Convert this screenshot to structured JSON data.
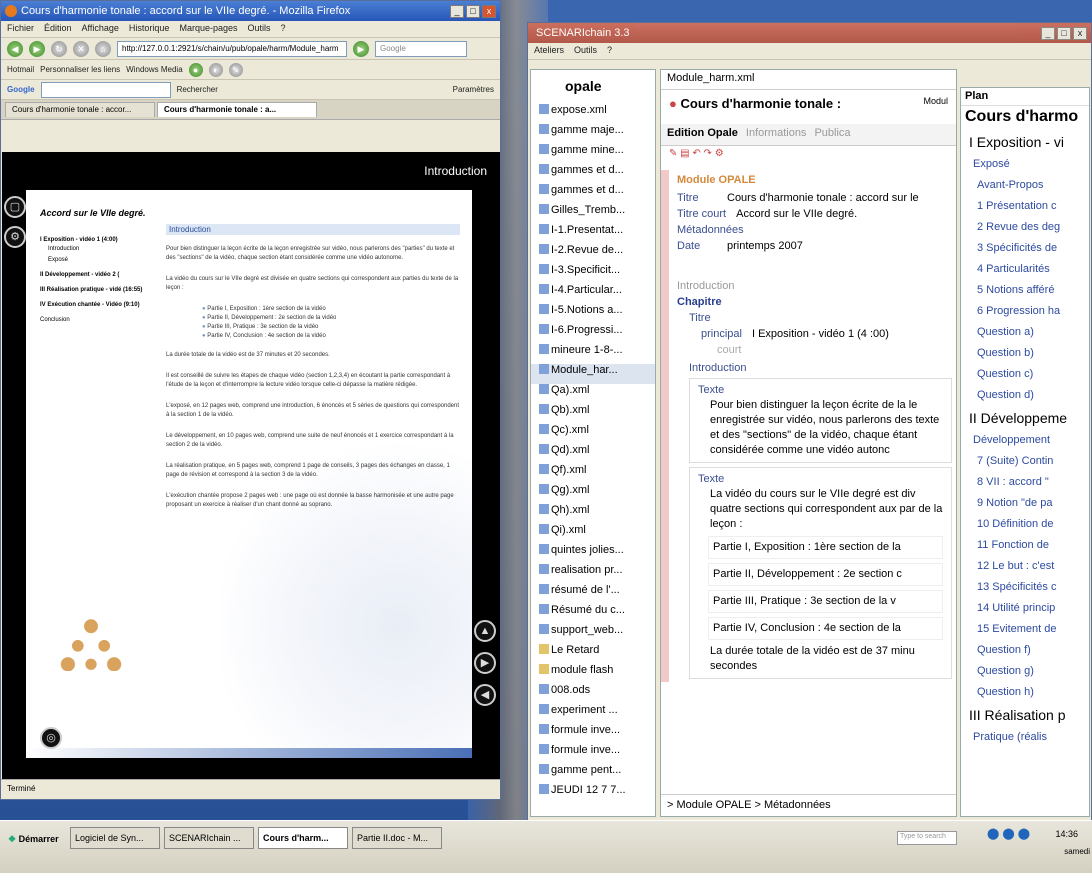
{
  "firefox": {
    "title": "Cours d'harmonie tonale : accord sur le VIIe degré. - Mozilla Firefox",
    "menu": [
      "Fichier",
      "Édition",
      "Affichage",
      "Historique",
      "Marque-pages",
      "Outils",
      "?"
    ],
    "url": "http://127.0.0.1:2921/s/chain/u/pub/opale/harm/Module_harm",
    "search_engine": "Google",
    "bookmarks": [
      "Hotmail",
      "Personnaliser les liens",
      "Windows Media"
    ],
    "google_toolbar": {
      "label": "Google",
      "search_button": "Rechercher",
      "settings": "Paramètres"
    },
    "tabs": [
      "Cours d'harmonie tonale : accor...",
      "Cours d'harmonie tonale : a..."
    ],
    "status": "Terminé",
    "flash": {
      "section_title": "Introduction",
      "page_title": "Accord sur le VIIe degré.",
      "nav": [
        {
          "label": "I Exposition - vidéo 1 (4:00)",
          "subs": [
            "Introduction",
            "Exposé"
          ]
        },
        {
          "label": "II Développement - vidéo 2 (",
          "subs": []
        },
        {
          "label": "III Réalisation pratique - vidé (16:55)",
          "subs": []
        },
        {
          "label": "IV Exécution chantée - Vidéo (9:10)",
          "subs": []
        },
        {
          "label": "Conclusion",
          "subs": []
        }
      ],
      "body_head": "Introduction",
      "paragraphs": [
        "Pour bien distinguer la leçon écrite de la leçon enregistrée sur vidéo, nous parlerons des \"parties\" du texte et des \"sections\" de la vidéo, chaque section étant considérée comme une vidéo autonome.",
        "La vidéo du cours sur le VIIe degré est divisée en quatre sections qui correspondent aux parties du texte de la leçon :"
      ],
      "bullets": [
        "Partie I, Exposition : 1ère section de la vidéo",
        "Partie II, Développement : 2e section de la vidéo",
        "Partie III, Pratique : 3e section de la vidéo",
        "Partie IV, Conclusion : 4e section de la vidéo"
      ],
      "paragraphs2": [
        "La durée totale de la vidéo est de 37 minutes et 20 secondes.",
        "Il est conseillé de suivre les étapes de chaque vidéo (section 1,2,3,4) en écoutant la partie correspondant à l'étude de la leçon et d'interrompre la lecture vidéo lorsque celle-ci dépasse la matière rédigée.",
        "L'exposé, en 12 pages web, comprend une introduction, 6 énoncés et 5 séries de questions qui correspondent à la section 1 de la vidéo.",
        "Le développement, en 10 pages web, comprend une suite de neuf énoncés et 1 exercice correspondant à la section 2 de la vidéo.",
        "La réalisation pratique, en 5 pages web, comprend 1 page de conseils, 3 pages des échanges en classe, 1 page de révision et correspond à la section 3 de la vidéo.",
        "L'exécution chantée propose 2 pages web : une page où est donnée la basse harmonisée et une autre page proposant un exercice à réaliser d'un chant donné au soprano."
      ]
    }
  },
  "scenari": {
    "title": "SCENARIchain 3.3",
    "menu": [
      "Ateliers",
      "Outils",
      "?"
    ],
    "workshop": "opale",
    "tree": [
      {
        "label": "expose.xml",
        "type": "file"
      },
      {
        "label": "gamme maje...",
        "type": "file"
      },
      {
        "label": "gamme mine...",
        "type": "file"
      },
      {
        "label": "gammes et d...",
        "type": "file"
      },
      {
        "label": "gammes et d...",
        "type": "file"
      },
      {
        "label": "Gilles_Tremb...",
        "type": "file"
      },
      {
        "label": "I-1.Presentat...",
        "type": "file"
      },
      {
        "label": "I-2.Revue de...",
        "type": "file"
      },
      {
        "label": "I-3.Specificit...",
        "type": "file"
      },
      {
        "label": "I-4.Particular...",
        "type": "file"
      },
      {
        "label": "I-5.Notions a...",
        "type": "file"
      },
      {
        "label": "I-6.Progressi...",
        "type": "file"
      },
      {
        "label": "mineure 1-8-...",
        "type": "file"
      },
      {
        "label": "Module_har...",
        "type": "file",
        "selected": true
      },
      {
        "label": "Qa).xml",
        "type": "file"
      },
      {
        "label": "Qb).xml",
        "type": "file"
      },
      {
        "label": "Qc).xml",
        "type": "file"
      },
      {
        "label": "Qd).xml",
        "type": "file"
      },
      {
        "label": "Qf).xml",
        "type": "file"
      },
      {
        "label": "Qg).xml",
        "type": "file"
      },
      {
        "label": "Qh).xml",
        "type": "file"
      },
      {
        "label": "Qi).xml",
        "type": "file"
      },
      {
        "label": "quintes jolies...",
        "type": "file"
      },
      {
        "label": "realisation pr...",
        "type": "file"
      },
      {
        "label": "résumé de l'...",
        "type": "file"
      },
      {
        "label": "Résumé du c...",
        "type": "file"
      },
      {
        "label": "support_web...",
        "type": "file"
      },
      {
        "label": "Le Retard",
        "type": "folder"
      },
      {
        "label": "module flash",
        "type": "folder"
      },
      {
        "label": "008.ods",
        "type": "file"
      },
      {
        "label": "experiment ...",
        "type": "file"
      },
      {
        "label": "formule inve...",
        "type": "file"
      },
      {
        "label": "formule inve...",
        "type": "file"
      },
      {
        "label": "gamme pent...",
        "type": "file"
      },
      {
        "label": "JEUDI 12 7 7...",
        "type": "file"
      }
    ],
    "editor": {
      "file": "Module_harm.xml",
      "title": "Cours d'harmonie tonale :",
      "title_line2": "accord sur le VIIe degré.",
      "modul_tag": "Modul",
      "tabs": [
        "Edition Opale",
        "Informations",
        "Publica"
      ],
      "module_label": "Module OPALE",
      "fields": [
        {
          "label": "Titre",
          "value": "Cours d'harmonie tonale : accord sur le"
        },
        {
          "label": "Titre court",
          "value": "Accord sur le VIIe degré."
        },
        {
          "label": "Métadonnées",
          "value": ""
        },
        {
          "label": "Date",
          "value": "printemps 2007"
        }
      ],
      "intro_label": "Introduction",
      "chapitre": "Chapitre",
      "titre": "Titre",
      "principal_label": "principal",
      "principal_value": "I Exposition - vidéo 1 (4 :00)",
      "court_label": "court",
      "introduction": "Introduction",
      "texte_label": "Texte",
      "texte1": "Pour bien distinguer la leçon écrite de la le enregistrée sur vidéo, nous parlerons des texte et des \"sections\" de la vidéo, chaque étant considérée comme une vidéo autonc",
      "texte2_label": "Texte",
      "texte2": "La vidéo du cours sur le VIIe degré est div quatre sections qui correspondent aux par de la leçon :",
      "bullets": [
        "Partie I, Exposition : 1ère section de la",
        "Partie II, Développement : 2e section c",
        "Partie III, Pratique : 3e section de la v",
        "Partie IV, Conclusion : 4e section de la"
      ],
      "duration": "La durée totale de la vidéo est de 37 minu secondes",
      "breadcrumb": "> Module OPALE > Métadonnées"
    },
    "plan": {
      "header": "Plan",
      "items": [
        {
          "label": "Cours d'harmo",
          "level": 1
        },
        {
          "label": "I Exposition - vi",
          "level": 2
        },
        {
          "label": "Exposé",
          "level": 3
        },
        {
          "label": "Avant-Propos",
          "level": 4
        },
        {
          "label": "1 Présentation c",
          "level": 4
        },
        {
          "label": "2 Revue des deg",
          "level": 4
        },
        {
          "label": "3 Spécificités de",
          "level": 4
        },
        {
          "label": "4 Particularités",
          "level": 4
        },
        {
          "label": "5 Notions afféré",
          "level": 4
        },
        {
          "label": "6 Progression ha",
          "level": 4
        },
        {
          "label": "Question a)",
          "level": 4
        },
        {
          "label": "Question b)",
          "level": 4
        },
        {
          "label": "Question c)",
          "level": 4
        },
        {
          "label": "Question d)",
          "level": 4
        },
        {
          "label": "II Développeme",
          "level": 2
        },
        {
          "label": "Développement",
          "level": 3
        },
        {
          "label": "7 (Suite) Contin",
          "level": 4
        },
        {
          "label": "8 VII : accord \"",
          "level": 4
        },
        {
          "label": "9 Notion \"de pa",
          "level": 4
        },
        {
          "label": "10 Définition de",
          "level": 4
        },
        {
          "label": "11 Fonction de",
          "level": 4
        },
        {
          "label": "12 Le but : c'est",
          "level": 4
        },
        {
          "label": "13 Spécificités c",
          "level": 4
        },
        {
          "label": "14 Utilité princip",
          "level": 4
        },
        {
          "label": "15 Evitement de",
          "level": 4
        },
        {
          "label": "Question f)",
          "level": 4
        },
        {
          "label": "Question g)",
          "level": 4
        },
        {
          "label": "Question h)",
          "level": 4
        },
        {
          "label": "III Réalisation p",
          "level": 2
        },
        {
          "label": "Pratique (réalis",
          "level": 3
        }
      ]
    }
  },
  "taskbar": {
    "start": "Démarrer",
    "tasks": [
      "Logiciel de Syn...",
      "SCENARIchain ...",
      "Cours d'harm...",
      "Partie II.doc - M..."
    ],
    "active_index": 2,
    "search_placeholder": "Type to search",
    "clock": "14:36",
    "day": "samedi"
  }
}
